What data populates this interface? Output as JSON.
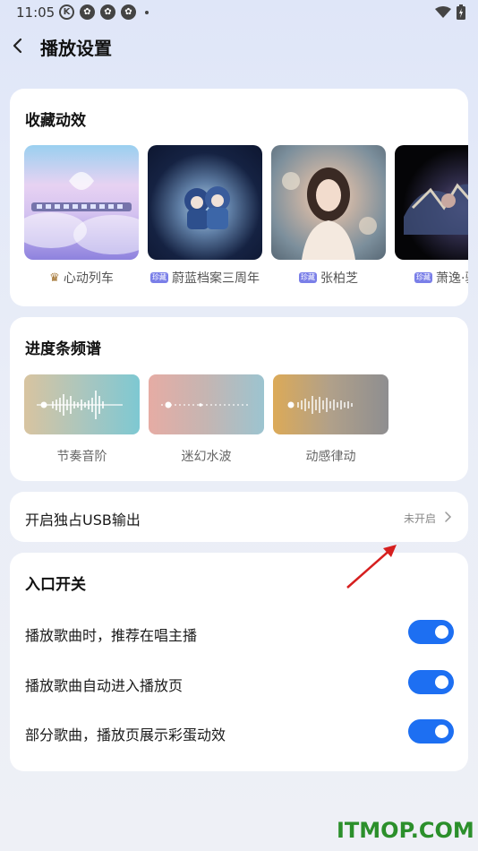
{
  "status_bar": {
    "time": "11:05",
    "icons": [
      "k-icon",
      "app-icon",
      "app-icon",
      "app-icon"
    ]
  },
  "header": {
    "title": "播放设置"
  },
  "favorites": {
    "title": "收藏动效",
    "items": [
      {
        "label": "心动列车",
        "badge": ""
      },
      {
        "label": "蔚蓝档案三周年",
        "badge": "珍藏"
      },
      {
        "label": "张柏芝",
        "badge": "珍藏"
      },
      {
        "label": "萧逸·驯",
        "badge": "珍藏"
      }
    ]
  },
  "spectrum": {
    "title": "进度条频谱",
    "items": [
      {
        "label": "节奏音阶"
      },
      {
        "label": "迷幻水波"
      },
      {
        "label": "动感律动"
      }
    ]
  },
  "usb": {
    "label": "开启独占USB输出",
    "value": "未开启"
  },
  "entry": {
    "title": "入口开关",
    "toggles": [
      {
        "label": "播放歌曲时，推荐在唱主播",
        "on": true
      },
      {
        "label": "播放歌曲自动进入播放页",
        "on": true
      },
      {
        "label": "部分歌曲，播放页展示彩蛋动效",
        "on": true
      }
    ]
  },
  "watermark": "ITMOP.COM",
  "colors": {
    "accent": "#1d6ff2",
    "badge": "#7a7fe8",
    "watermark": "#2b8f2b"
  }
}
